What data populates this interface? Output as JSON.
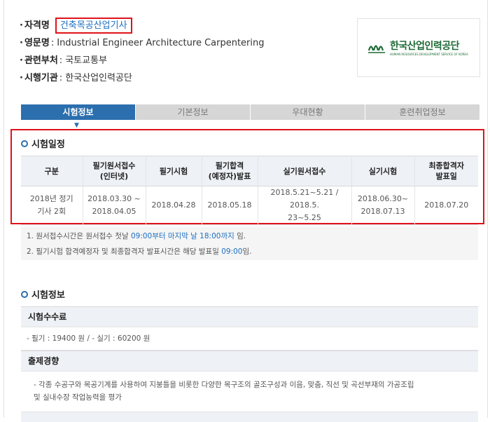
{
  "info": {
    "qualification_label": "자격명",
    "qualification_value": "건축목공산업기사",
    "english_label": "영문명",
    "english_value": "Industrial Engineer Architecture Carpentering",
    "ministry_label": "관련부처",
    "ministry_value": "국토교통부",
    "agency_label": "시행기관",
    "agency_value": "한국산업인력공단",
    "separator": ":"
  },
  "logo": {
    "name": "한국산업인력공단",
    "subtitle": "HUMAN RESOURCES DEVELOPMENT SERVICE OF KOREA",
    "icon": "hrdk-logo-icon"
  },
  "tabs": [
    {
      "label": "시험정보",
      "active": true
    },
    {
      "label": "기본정보",
      "active": false
    },
    {
      "label": "우대현황",
      "active": false
    },
    {
      "label": "훈련취업정보",
      "active": false
    }
  ],
  "schedule": {
    "title": "시험일정",
    "headers": [
      "구분",
      "필기원서접수\n(인터넷)",
      "필기시험",
      "필기합격\n(예정자)발표",
      "실기원서접수",
      "실기시험",
      "최종합격자\n발표일"
    ],
    "rows": [
      [
        "2018년 정기\n기사 2회",
        "2018.03.30 ~\n2018.04.05",
        "2018.04.28",
        "2018.05.18",
        "2018.5.21~5.21 / 2018.5.\n23~5.25",
        "2018.06.30~\n2018.07.13",
        "2018.07.20"
      ]
    ]
  },
  "notes": [
    {
      "prefix": "1. 원서접수시간은 원서접수 첫날 ",
      "highlight": "09:00부터 마지막 날 18:00까지",
      "suffix": " 임."
    },
    {
      "prefix": "2. 필기시험 합격예정자 및 최종합격자 발표시간은 해당 발표일 ",
      "highlight": "09:00",
      "suffix": "임."
    }
  ],
  "exam_info": {
    "title": "시험정보",
    "fee_heading": "시험수수료",
    "fee_text": "- 필기 : 19400 원 / - 실기 : 60200 원",
    "trend_heading": "출제경향",
    "trend_text_line1": "- 각종 수공구와 목공기계를 사용하여 지붕틀을 비롯한 다양한 목구조의 골조구성과 이음, 맞춤, 직선 및 곡선부재의 가공조립",
    "trend_text_line2": "및 실내수장 작업능력을 평가"
  },
  "colors": {
    "accent": "#2c6fae",
    "highlight_border": "#e0121a",
    "link": "#1e6fbf",
    "logo_green": "#1c6a35"
  }
}
